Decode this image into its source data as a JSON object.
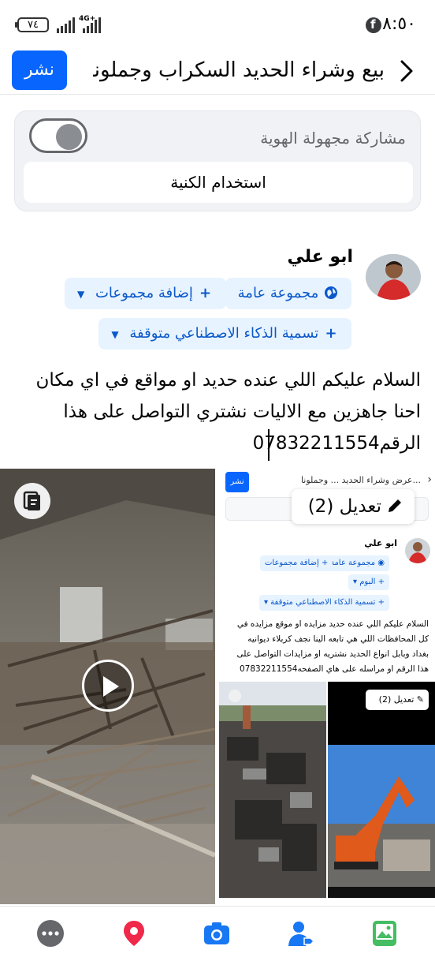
{
  "status_bar": {
    "time": "٨:٥٠",
    "battery": "٧٤",
    "network": "4G+"
  },
  "header": {
    "title": "بيع وشراء الحديد السكراب وجملونا...",
    "post_button": "نشر"
  },
  "anonymous": {
    "label": "مشاركة مجهولة الهوية",
    "toggle_on": false,
    "nickname_button": "استخدام الكنية"
  },
  "author": {
    "name": "ابو علي"
  },
  "chips": {
    "audience": "مجموعة عامة",
    "add_groups": "إضافة مجموعات",
    "ai_label": "تسمية الذكاء الاصطناعي متوقفة"
  },
  "post_text": "السلام عليكم اللي عنده حديد او مواقع في اي مكان احنا جاهزين مع الاليات نشتري التواصل على هذا الرقم07832211554",
  "media": {
    "edit_label": "تعديل (2)"
  },
  "mini_screenshot": {
    "title": "...عرض وشراء الحديد ... وجملونا",
    "post_button": "نشر",
    "author": "ابو علي",
    "chip_audience": "مجموعة عامة",
    "chip_add_groups": "إضافة مجموعات",
    "chip_album": "البوم",
    "chip_ai": "تسمية الذكاء الاصطناعي متوقفة",
    "text_lines": [
      "السلام عليكم اللي عنده حديد مزايده او موقع مزايده في",
      "كل المحافظات اللي هي تابعه الينا نجف كربلاء ديوانيه",
      "بغداد وبابل انواع الحديد نشتريه او مزايدات التواصل على",
      "هذا الرقم او مراسله على هاي الصفحه07832211554"
    ],
    "edit_label": "تعديل (2)"
  },
  "bottom_bar": {
    "items": [
      "more-icon",
      "location-icon",
      "camera-icon",
      "tag-people-icon",
      "photo-icon"
    ]
  },
  "colors": {
    "primary": "#0866ff",
    "chip_bg": "#e7f3ff",
    "chip_text": "#0a58ca",
    "location": "#f02849",
    "camera": "#1877f2",
    "photo": "#45bd62"
  }
}
